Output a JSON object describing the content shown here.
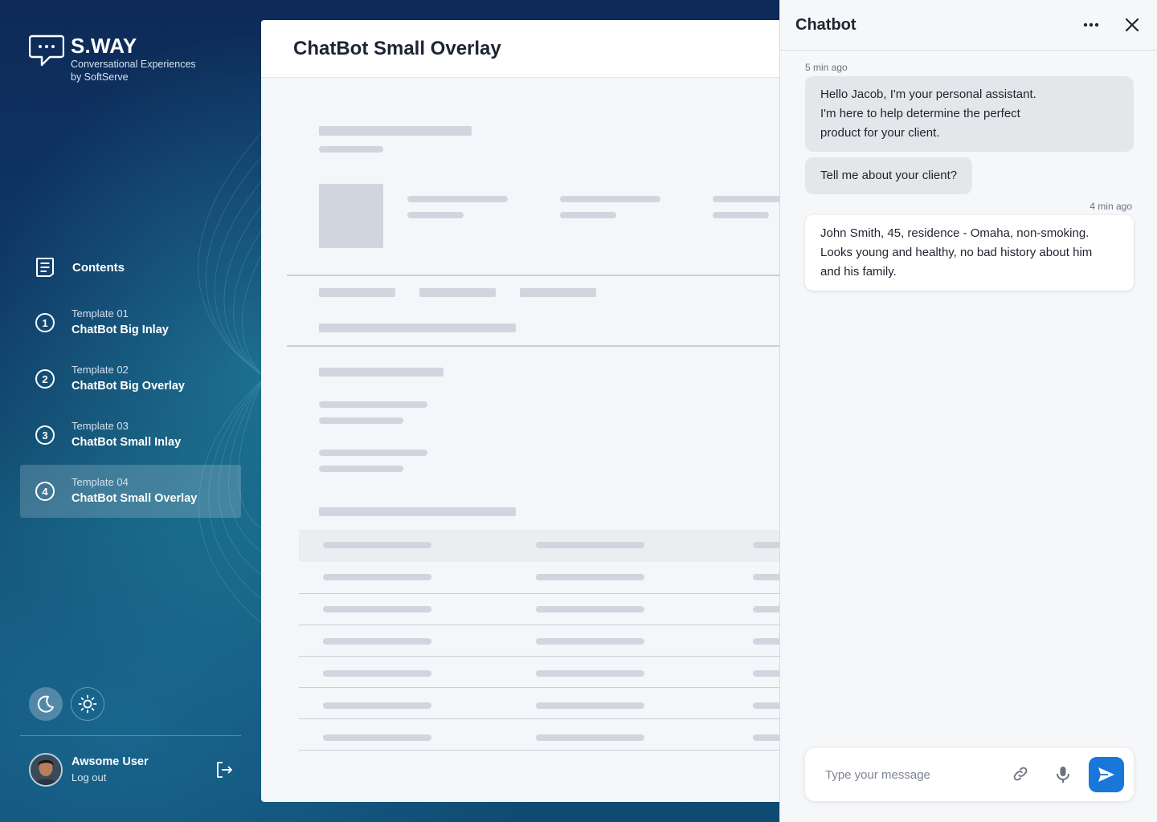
{
  "brand": {
    "title": "S.WAY",
    "subtitle_line1": "Conversational Experiences",
    "subtitle_line2": "by SoftServe"
  },
  "sidebar": {
    "contents_label": "Contents",
    "items": [
      {
        "number": "1",
        "small": "Template 01",
        "label": "ChatBot Big Inlay",
        "active": false
      },
      {
        "number": "2",
        "small": "Template 02",
        "label": "ChatBot Big Overlay",
        "active": false
      },
      {
        "number": "3",
        "small": "Template 03",
        "label": "ChatBot Small Inlay",
        "active": false
      },
      {
        "number": "4",
        "small": "Template 04",
        "label": "ChatBot Small Overlay",
        "active": true
      }
    ],
    "theme": {
      "dark_icon": "moon-icon",
      "light_icon": "sun-icon",
      "selected": "dark"
    },
    "user": {
      "name": "Awsome User",
      "logout_label": "Log out"
    }
  },
  "main": {
    "title": "ChatBot Small Overlay"
  },
  "chat": {
    "title": "Chatbot",
    "messages": [
      {
        "from": "bot",
        "time": "5 min ago",
        "lines": [
          "Hello Jacob, I'm your personal assistant.",
          "I'm here to help determine the perfect",
          "product for your client."
        ]
      },
      {
        "from": "bot",
        "time": "",
        "lines": [
          "Tell me about your client?"
        ]
      },
      {
        "from": "user",
        "time": "4  min ago",
        "lines": [
          "John Smith, 45, residence - Omaha, non-smoking.",
          "Looks young and healthy, no bad history about him",
          "and his family."
        ]
      }
    ],
    "input_placeholder": "Type your message",
    "input_value": "",
    "colors": {
      "accent": "#1877d9",
      "bot_bubble": "#e4e6ea",
      "user_bubble": "#ffffff"
    }
  }
}
